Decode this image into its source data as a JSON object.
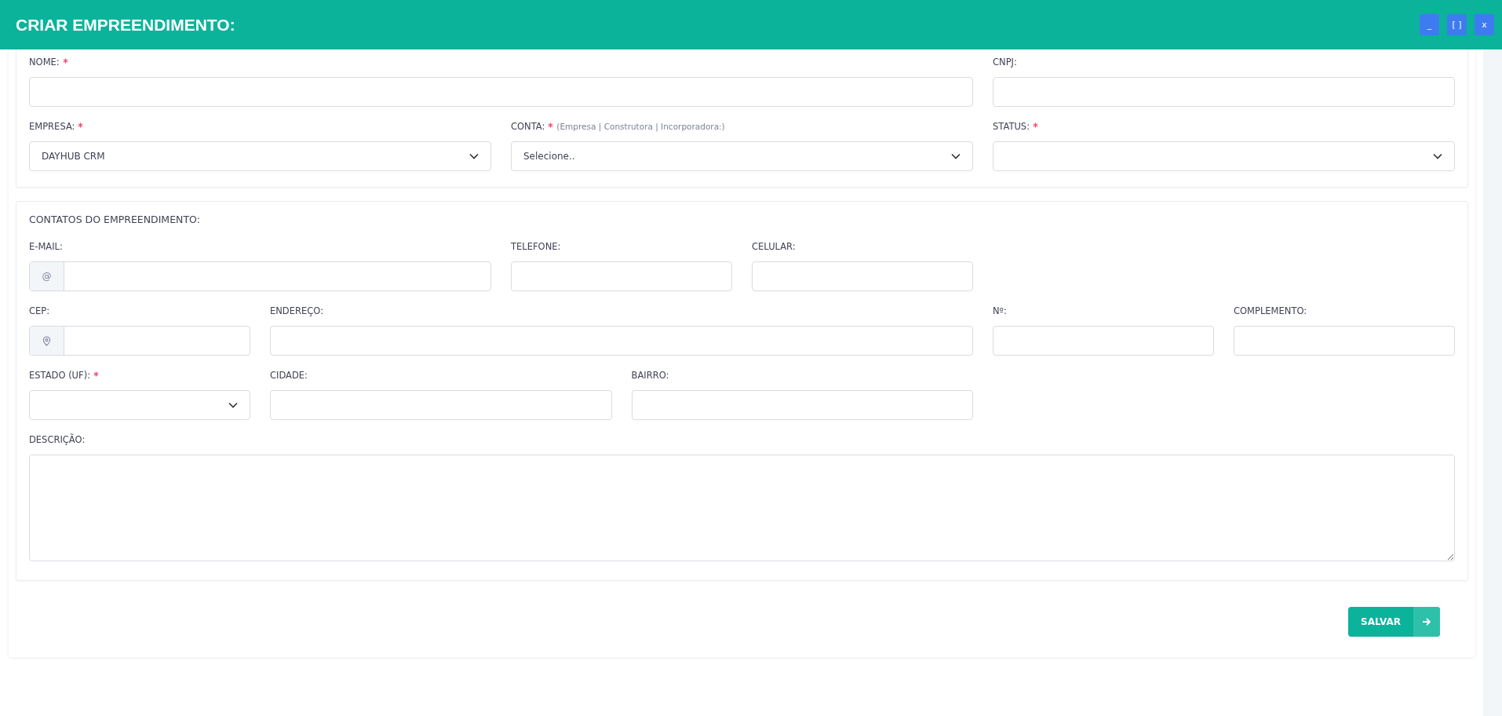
{
  "window": {
    "title": "CRIAR EMPREENDIMENTO:",
    "controls": [
      "_",
      "[ ]",
      "x"
    ]
  },
  "sections": [
    {
      "field_groups": [
        [
          {
            "kind": "text",
            "label": "NOME:",
            "required": true
          },
          {
            "kind": "text",
            "label": "CNPJ:",
            "required": false
          }
        ],
        [
          {
            "kind": "select",
            "label": "EMPRESA:",
            "required": true,
            "value": "DAYHUB CRM"
          },
          {
            "kind": "select",
            "label": "CONTA:",
            "required": true,
            "hint": "(Empresa | Construtora | Incorporadora:)",
            "value": "Selecione.."
          },
          {
            "kind": "select",
            "label": "STATUS:",
            "required": true
          }
        ]
      ]
    },
    {
      "heading": "CONTATOS DO EMPREENDIMENTO:",
      "field_groups": [
        [
          {
            "kind": "prefixed",
            "prefix": "@",
            "label": "E-MAIL:",
            "required": false
          },
          {
            "kind": "text",
            "label": "TELEFONE:",
            "required": false
          },
          {
            "kind": "text",
            "label": "CELULAR:",
            "required": false
          }
        ],
        [
          {
            "kind": "location",
            "label": "CEP:",
            "required": false
          },
          {
            "kind": "text",
            "label": "ENDEREÇO:",
            "required": false
          },
          {
            "kind": "text",
            "label": "Nº:",
            "required": false
          },
          {
            "kind": "text",
            "label": "COMPLEMENTO:",
            "required": false
          }
        ],
        [
          {
            "kind": "select",
            "label": "ESTADO (UF):",
            "required": true
          },
          {
            "kind": "text",
            "label": "CIDADE:",
            "required": false
          },
          {
            "kind": "text",
            "label": "BAIRRO:",
            "required": false
          }
        ],
        [
          {
            "kind": "textarea",
            "label": "DESCRIÇÃO:",
            "required": false
          }
        ]
      ]
    }
  ],
  "save_button": {
    "label": "SALVAR"
  }
}
